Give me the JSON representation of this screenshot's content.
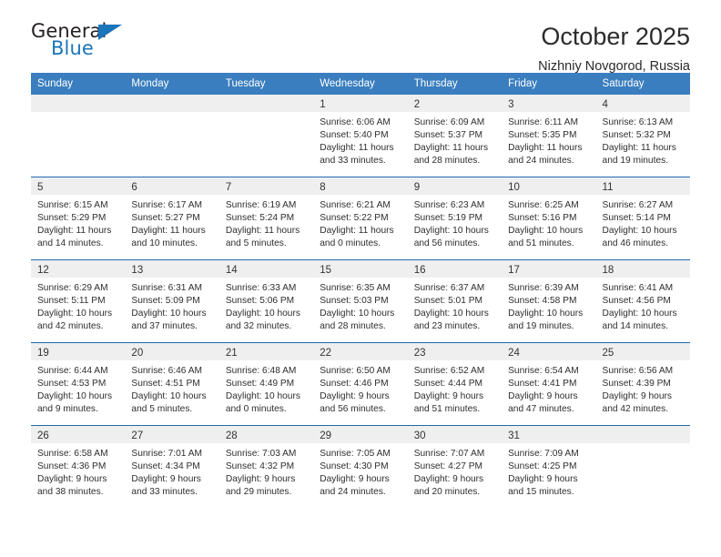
{
  "brand": {
    "name_top": "General",
    "name_bottom": "Blue",
    "accent_color": "#1b75bb"
  },
  "header": {
    "title": "October 2025",
    "subtitle": "Nizhniy Novgorod, Russia"
  },
  "theme": {
    "header_row_bg": "#3a7ebf",
    "row_divider": "#1f6bb0",
    "daynum_bg": "#efefef",
    "text": "#2e2e2e"
  },
  "weekday_headers": [
    "Sunday",
    "Monday",
    "Tuesday",
    "Wednesday",
    "Thursday",
    "Friday",
    "Saturday"
  ],
  "labels": {
    "sunrise_prefix": "Sunrise: ",
    "sunset_prefix": "Sunset: ",
    "daylight_prefix": "Daylight: "
  },
  "weeks": [
    [
      {
        "day": "",
        "blank": true
      },
      {
        "day": "",
        "blank": true
      },
      {
        "day": "",
        "blank": true
      },
      {
        "day": "1",
        "sunrise": "Sunrise: 6:06 AM",
        "sunset": "Sunset: 5:40 PM",
        "daylight": "Daylight: 11 hours and 33 minutes."
      },
      {
        "day": "2",
        "sunrise": "Sunrise: 6:09 AM",
        "sunset": "Sunset: 5:37 PM",
        "daylight": "Daylight: 11 hours and 28 minutes."
      },
      {
        "day": "3",
        "sunrise": "Sunrise: 6:11 AM",
        "sunset": "Sunset: 5:35 PM",
        "daylight": "Daylight: 11 hours and 24 minutes."
      },
      {
        "day": "4",
        "sunrise": "Sunrise: 6:13 AM",
        "sunset": "Sunset: 5:32 PM",
        "daylight": "Daylight: 11 hours and 19 minutes."
      }
    ],
    [
      {
        "day": "5",
        "sunrise": "Sunrise: 6:15 AM",
        "sunset": "Sunset: 5:29 PM",
        "daylight": "Daylight: 11 hours and 14 minutes."
      },
      {
        "day": "6",
        "sunrise": "Sunrise: 6:17 AM",
        "sunset": "Sunset: 5:27 PM",
        "daylight": "Daylight: 11 hours and 10 minutes."
      },
      {
        "day": "7",
        "sunrise": "Sunrise: 6:19 AM",
        "sunset": "Sunset: 5:24 PM",
        "daylight": "Daylight: 11 hours and 5 minutes."
      },
      {
        "day": "8",
        "sunrise": "Sunrise: 6:21 AM",
        "sunset": "Sunset: 5:22 PM",
        "daylight": "Daylight: 11 hours and 0 minutes."
      },
      {
        "day": "9",
        "sunrise": "Sunrise: 6:23 AM",
        "sunset": "Sunset: 5:19 PM",
        "daylight": "Daylight: 10 hours and 56 minutes."
      },
      {
        "day": "10",
        "sunrise": "Sunrise: 6:25 AM",
        "sunset": "Sunset: 5:16 PM",
        "daylight": "Daylight: 10 hours and 51 minutes."
      },
      {
        "day": "11",
        "sunrise": "Sunrise: 6:27 AM",
        "sunset": "Sunset: 5:14 PM",
        "daylight": "Daylight: 10 hours and 46 minutes."
      }
    ],
    [
      {
        "day": "12",
        "sunrise": "Sunrise: 6:29 AM",
        "sunset": "Sunset: 5:11 PM",
        "daylight": "Daylight: 10 hours and 42 minutes."
      },
      {
        "day": "13",
        "sunrise": "Sunrise: 6:31 AM",
        "sunset": "Sunset: 5:09 PM",
        "daylight": "Daylight: 10 hours and 37 minutes."
      },
      {
        "day": "14",
        "sunrise": "Sunrise: 6:33 AM",
        "sunset": "Sunset: 5:06 PM",
        "daylight": "Daylight: 10 hours and 32 minutes."
      },
      {
        "day": "15",
        "sunrise": "Sunrise: 6:35 AM",
        "sunset": "Sunset: 5:03 PM",
        "daylight": "Daylight: 10 hours and 28 minutes."
      },
      {
        "day": "16",
        "sunrise": "Sunrise: 6:37 AM",
        "sunset": "Sunset: 5:01 PM",
        "daylight": "Daylight: 10 hours and 23 minutes."
      },
      {
        "day": "17",
        "sunrise": "Sunrise: 6:39 AM",
        "sunset": "Sunset: 4:58 PM",
        "daylight": "Daylight: 10 hours and 19 minutes."
      },
      {
        "day": "18",
        "sunrise": "Sunrise: 6:41 AM",
        "sunset": "Sunset: 4:56 PM",
        "daylight": "Daylight: 10 hours and 14 minutes."
      }
    ],
    [
      {
        "day": "19",
        "sunrise": "Sunrise: 6:44 AM",
        "sunset": "Sunset: 4:53 PM",
        "daylight": "Daylight: 10 hours and 9 minutes."
      },
      {
        "day": "20",
        "sunrise": "Sunrise: 6:46 AM",
        "sunset": "Sunset: 4:51 PM",
        "daylight": "Daylight: 10 hours and 5 minutes."
      },
      {
        "day": "21",
        "sunrise": "Sunrise: 6:48 AM",
        "sunset": "Sunset: 4:49 PM",
        "daylight": "Daylight: 10 hours and 0 minutes."
      },
      {
        "day": "22",
        "sunrise": "Sunrise: 6:50 AM",
        "sunset": "Sunset: 4:46 PM",
        "daylight": "Daylight: 9 hours and 56 minutes."
      },
      {
        "day": "23",
        "sunrise": "Sunrise: 6:52 AM",
        "sunset": "Sunset: 4:44 PM",
        "daylight": "Daylight: 9 hours and 51 minutes."
      },
      {
        "day": "24",
        "sunrise": "Sunrise: 6:54 AM",
        "sunset": "Sunset: 4:41 PM",
        "daylight": "Daylight: 9 hours and 47 minutes."
      },
      {
        "day": "25",
        "sunrise": "Sunrise: 6:56 AM",
        "sunset": "Sunset: 4:39 PM",
        "daylight": "Daylight: 9 hours and 42 minutes."
      }
    ],
    [
      {
        "day": "26",
        "sunrise": "Sunrise: 6:58 AM",
        "sunset": "Sunset: 4:36 PM",
        "daylight": "Daylight: 9 hours and 38 minutes."
      },
      {
        "day": "27",
        "sunrise": "Sunrise: 7:01 AM",
        "sunset": "Sunset: 4:34 PM",
        "daylight": "Daylight: 9 hours and 33 minutes."
      },
      {
        "day": "28",
        "sunrise": "Sunrise: 7:03 AM",
        "sunset": "Sunset: 4:32 PM",
        "daylight": "Daylight: 9 hours and 29 minutes."
      },
      {
        "day": "29",
        "sunrise": "Sunrise: 7:05 AM",
        "sunset": "Sunset: 4:30 PM",
        "daylight": "Daylight: 9 hours and 24 minutes."
      },
      {
        "day": "30",
        "sunrise": "Sunrise: 7:07 AM",
        "sunset": "Sunset: 4:27 PM",
        "daylight": "Daylight: 9 hours and 20 minutes."
      },
      {
        "day": "31",
        "sunrise": "Sunrise: 7:09 AM",
        "sunset": "Sunset: 4:25 PM",
        "daylight": "Daylight: 9 hours and 15 minutes."
      },
      {
        "day": "",
        "blank": true
      }
    ]
  ]
}
